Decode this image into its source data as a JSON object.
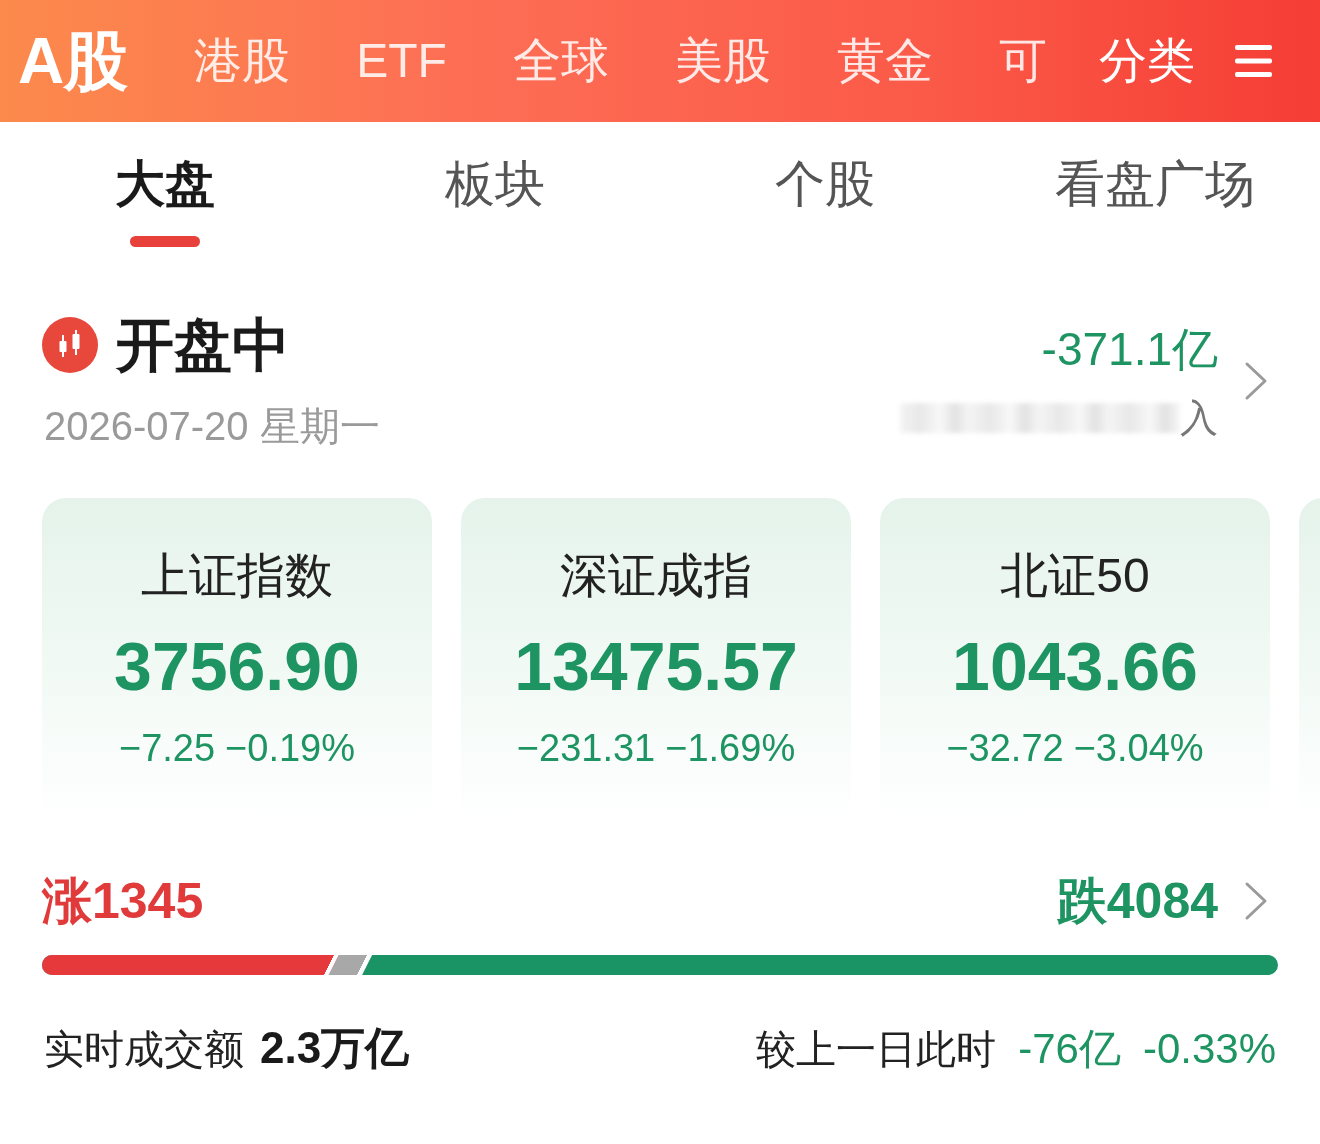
{
  "top_nav": {
    "items": [
      {
        "label": "A股",
        "selected": true
      },
      {
        "label": "港股",
        "selected": false
      },
      {
        "label": "ETF",
        "selected": false
      },
      {
        "label": "全球",
        "selected": false
      },
      {
        "label": "美股",
        "selected": false
      },
      {
        "label": "黄金",
        "selected": false
      },
      {
        "label": "可",
        "selected": false
      }
    ],
    "category_button": "分类"
  },
  "tabs": [
    {
      "label": "大盘",
      "selected": true
    },
    {
      "label": "板块",
      "selected": false
    },
    {
      "label": "个股",
      "selected": false
    },
    {
      "label": "看盘广场",
      "selected": false
    }
  ],
  "market_status": {
    "status": "开盘中",
    "date": "2026-07-20 星期一",
    "flow_value": "-371.1亿",
    "flow_label": "入"
  },
  "index_cards": [
    {
      "name": "上证指数",
      "value": "3756.90",
      "change": "−7.25",
      "change_pct": "−0.19%"
    },
    {
      "name": "深证成指",
      "value": "13475.57",
      "change": "−231.31",
      "change_pct": "−1.69%"
    },
    {
      "name": "北证50",
      "value": "1043.66",
      "change": "−32.72",
      "change_pct": "−3.04%"
    }
  ],
  "breadth": {
    "up": "涨1345",
    "down": "跌4084",
    "bar": {
      "rise_and_flat_share": {
        "level": 0.267
      },
      "rise_share": {
        "level": 0.24
      }
    }
  },
  "turnover": {
    "label": "实时成交额",
    "value": "2.3万亿",
    "compare_label": "较上一日此时",
    "compare_amount": "-76亿",
    "compare_pct": "-0.33%"
  }
}
